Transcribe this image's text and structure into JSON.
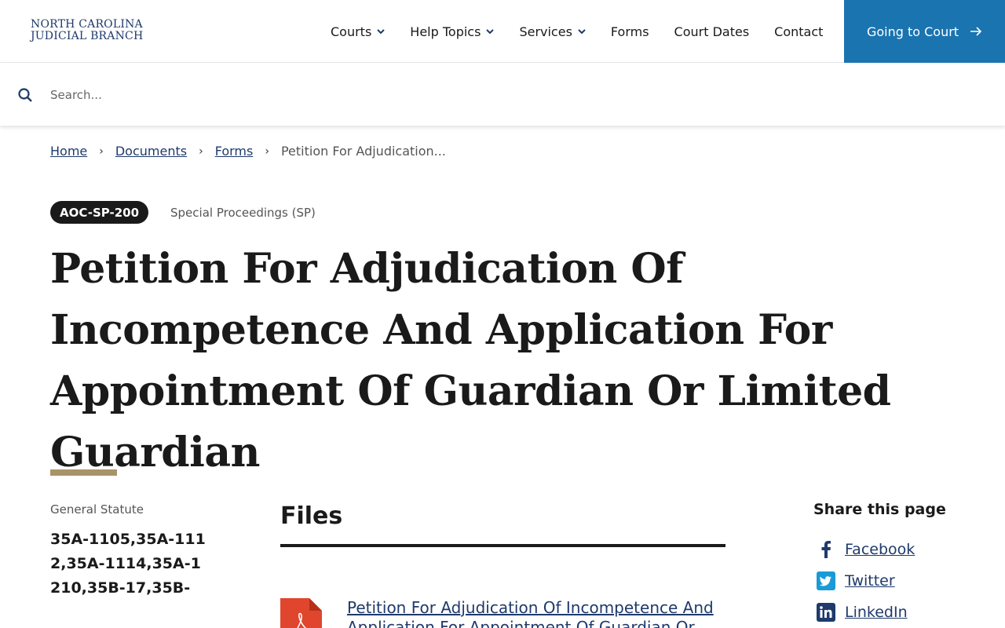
{
  "header": {
    "logo_line1": "North Carolina",
    "logo_line2": "Judicial Branch",
    "nav": [
      {
        "label": "Courts",
        "has_dropdown": true
      },
      {
        "label": "Help Topics",
        "has_dropdown": true
      },
      {
        "label": "Services",
        "has_dropdown": true
      },
      {
        "label": "Forms",
        "has_dropdown": false
      },
      {
        "label": "Court Dates",
        "has_dropdown": false
      },
      {
        "label": "Contact",
        "has_dropdown": false
      }
    ],
    "cta_label": "Going to Court",
    "cta_color": "#1a74b0"
  },
  "search": {
    "placeholder": "Search..."
  },
  "breadcrumb": {
    "items": [
      "Home",
      "Documents",
      "Forms"
    ],
    "current": "Petition For Adjudication..."
  },
  "form": {
    "code": "AOC-SP-200",
    "category": "Special Proceedings (SP)",
    "title": "Petition For Adjudication Of Incompetence And Application For Appointment Of Guardian Or Limited Guardian"
  },
  "meta": {
    "label": "General Statute",
    "value": "35A-1105,35A-1112,35A-1114,35A-1210,35B-17,35B-"
  },
  "files": {
    "heading": "Files",
    "items": [
      {
        "label": "Petition For Adjudication Of Incompetence And Application For Appointment Of Guardian Or",
        "icon": "pdf-icon"
      }
    ]
  },
  "share": {
    "heading": "Share this page",
    "items": [
      {
        "label": "Facebook",
        "icon": "facebook-icon"
      },
      {
        "label": "Twitter",
        "icon": "twitter-icon"
      },
      {
        "label": "LinkedIn",
        "icon": "linkedin-icon"
      }
    ]
  },
  "colors": {
    "brand_navy": "#1f3a6b",
    "accent_tan": "#a89468",
    "pdf_red": "#e0462e"
  }
}
